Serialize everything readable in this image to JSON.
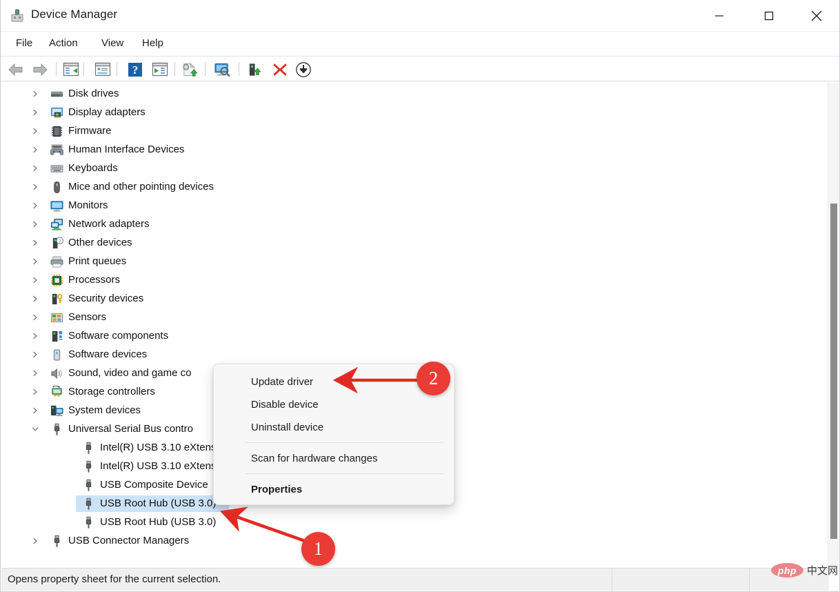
{
  "window": {
    "title": "Device Manager",
    "icon": "device-manager-icon",
    "controls": {
      "minimize": "minimize-icon",
      "maximize": "maximize-icon",
      "close": "close-icon"
    }
  },
  "menubar": {
    "items": [
      {
        "label": "File"
      },
      {
        "label": "Action"
      },
      {
        "label": "View"
      },
      {
        "label": "Help"
      }
    ]
  },
  "toolbar": {
    "buttons": [
      {
        "name": "back-icon"
      },
      {
        "name": "forward-icon"
      },
      {
        "name": "show-hide-console-tree-icon"
      },
      {
        "name": "properties-icon"
      },
      {
        "name": "help-icon"
      },
      {
        "name": "show-hide-action-pane-icon"
      },
      {
        "name": "update-driver-icon"
      },
      {
        "name": "scan-for-hardware-changes-icon"
      },
      {
        "name": "enable-device-icon"
      },
      {
        "name": "uninstall-device-icon"
      },
      {
        "name": "disable-device-icon"
      }
    ]
  },
  "tree": {
    "items": [
      {
        "label": "Disk drives",
        "level": 1,
        "expander": "collapsed",
        "icon": "disk-drive-icon"
      },
      {
        "label": "Display adapters",
        "level": 1,
        "expander": "collapsed",
        "icon": "display-adapter-icon"
      },
      {
        "label": "Firmware",
        "level": 1,
        "expander": "collapsed",
        "icon": "firmware-icon"
      },
      {
        "label": "Human Interface Devices",
        "level": 1,
        "expander": "collapsed",
        "icon": "hid-icon"
      },
      {
        "label": "Keyboards",
        "level": 1,
        "expander": "collapsed",
        "icon": "keyboard-icon"
      },
      {
        "label": "Mice and other pointing devices",
        "level": 1,
        "expander": "collapsed",
        "icon": "mouse-icon"
      },
      {
        "label": "Monitors",
        "level": 1,
        "expander": "collapsed",
        "icon": "monitor-icon"
      },
      {
        "label": "Network adapters",
        "level": 1,
        "expander": "collapsed",
        "icon": "network-adapter-icon"
      },
      {
        "label": "Other devices",
        "level": 1,
        "expander": "collapsed",
        "icon": "other-device-icon"
      },
      {
        "label": "Print queues",
        "level": 1,
        "expander": "collapsed",
        "icon": "printer-icon"
      },
      {
        "label": "Processors",
        "level": 1,
        "expander": "collapsed",
        "icon": "processor-icon"
      },
      {
        "label": "Security devices",
        "level": 1,
        "expander": "collapsed",
        "icon": "security-device-icon"
      },
      {
        "label": "Sensors",
        "level": 1,
        "expander": "collapsed",
        "icon": "sensor-icon"
      },
      {
        "label": "Software components",
        "level": 1,
        "expander": "collapsed",
        "icon": "software-component-icon"
      },
      {
        "label": "Software devices",
        "level": 1,
        "expander": "collapsed",
        "icon": "software-device-icon"
      },
      {
        "label": "Sound, video and game co",
        "level": 1,
        "expander": "collapsed",
        "icon": "sound-device-icon"
      },
      {
        "label": "Storage controllers",
        "level": 1,
        "expander": "collapsed",
        "icon": "storage-controller-icon"
      },
      {
        "label": "System devices",
        "level": 1,
        "expander": "collapsed",
        "icon": "system-device-icon"
      },
      {
        "label": "Universal Serial Bus contro",
        "level": 1,
        "expander": "expanded",
        "icon": "usb-icon"
      },
      {
        "label": "Intel(R) USB 3.10 eXtens",
        "level": 2,
        "expander": "none",
        "icon": "usb-icon"
      },
      {
        "label": "Intel(R) USB 3.10 eXtens",
        "level": 2,
        "expander": "none",
        "icon": "usb-icon"
      },
      {
        "label": "USB Composite Device",
        "level": 2,
        "expander": "none",
        "icon": "usb-icon"
      },
      {
        "label": "USB Root Hub (USB 3.0)",
        "level": 2,
        "expander": "none",
        "icon": "usb-icon",
        "selected": true
      },
      {
        "label": "USB Root Hub (USB 3.0)",
        "level": 2,
        "expander": "none",
        "icon": "usb-icon"
      },
      {
        "label": "USB Connector Managers",
        "level": 1,
        "expander": "collapsed",
        "icon": "usb-icon"
      }
    ]
  },
  "context_menu": {
    "items": [
      {
        "label": "Update driver",
        "bold": false
      },
      {
        "label": "Disable device",
        "bold": false
      },
      {
        "label": "Uninstall device",
        "bold": false
      },
      {
        "label": "Scan for hardware changes",
        "bold": false
      },
      {
        "label": "Properties",
        "bold": true
      }
    ]
  },
  "statusbar": {
    "text": "Opens property sheet for the current selection."
  },
  "annotations": {
    "badges": [
      {
        "label": "1",
        "target": "selected-usb-root-hub-row"
      },
      {
        "label": "2",
        "target": "update-driver-menu-item"
      }
    ],
    "arrow_color": "#e02b24"
  },
  "watermark": {
    "logo": "php",
    "text": "中文网"
  },
  "colors": {
    "selection": "#cce3f7",
    "accent_red": "#ea3b35",
    "menu_bg": "#f7f7f7",
    "status_bg": "#f0f0f0"
  }
}
